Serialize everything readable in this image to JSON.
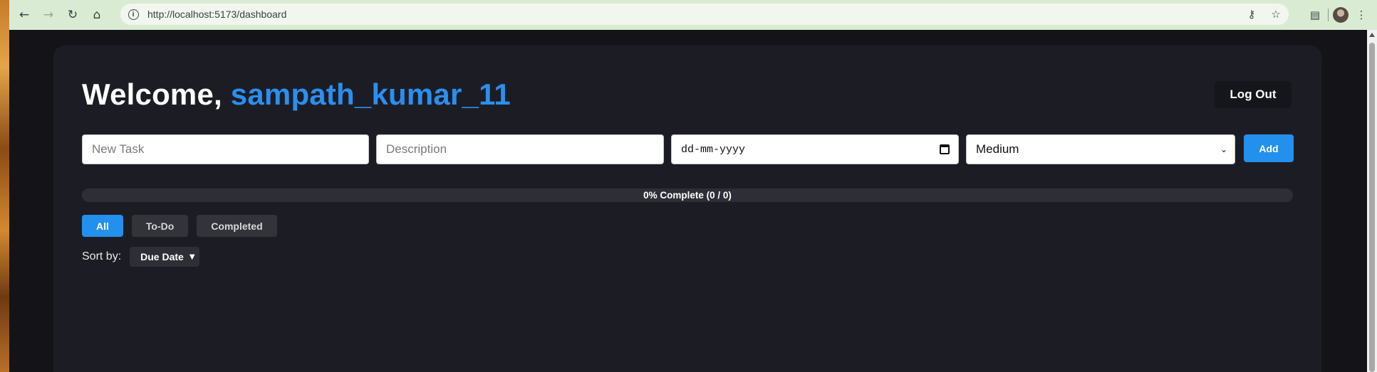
{
  "browser": {
    "url": "http://localhost:5173/dashboard",
    "nav": {
      "back_icon": "arrow-left-icon",
      "forward_icon": "arrow-right-icon",
      "reload_icon": "reload-icon",
      "home_icon": "home-icon"
    }
  },
  "header": {
    "welcome_prefix": "Welcome,",
    "username": "sampath_kumar_11",
    "logout_label": "Log Out"
  },
  "task_form": {
    "title_placeholder": "New Task",
    "description_placeholder": "Description",
    "date_value": "dd-mm-yyyy",
    "priority_value": "Medium",
    "add_label": "Add"
  },
  "progress": {
    "text": "0% Complete (0 / 0)",
    "fraction": 0
  },
  "filters": [
    {
      "label": "All",
      "active": true
    },
    {
      "label": "To-Do",
      "active": false
    },
    {
      "label": "Completed",
      "active": false
    }
  ],
  "sort": {
    "label": "Sort by:",
    "value": "Due Date"
  },
  "colors": {
    "accent": "#2390ee",
    "username": "#2b8ff0",
    "card_bg": "#1c1d24",
    "page_bg": "#141418"
  }
}
